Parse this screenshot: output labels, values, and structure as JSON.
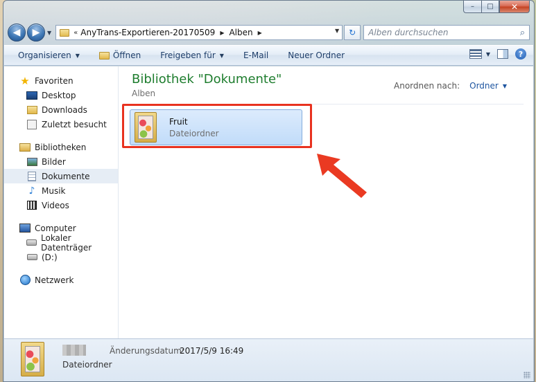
{
  "window": {
    "caption_minimize": "–",
    "caption_maximize": "□",
    "caption_close": "✕"
  },
  "navigation": {
    "back_icon": "◀",
    "forward_icon": "▶",
    "recent_dropdown": "▼"
  },
  "address_bar": {
    "overflow_chevron": "«",
    "segments": [
      "AnyTrans-Exportieren-20170509",
      "Alben"
    ],
    "separator": "▶",
    "dropdown": "▼",
    "refresh_icon": "↻"
  },
  "search": {
    "placeholder": "Alben durchsuchen",
    "icon": "⌕"
  },
  "toolbar": {
    "organize": "Organisieren",
    "open": "Öffnen",
    "share": "Freigeben für",
    "email": "E-Mail",
    "new_folder": "Neuer Ordner",
    "dropdown": "▼",
    "help": "?"
  },
  "sidebar": {
    "favorites": {
      "label": "Favoriten",
      "items": [
        "Desktop",
        "Downloads",
        "Zuletzt besucht"
      ]
    },
    "libraries": {
      "label": "Bibliotheken",
      "items": [
        "Bilder",
        "Dokumente",
        "Musik",
        "Videos"
      ],
      "selected": "Dokumente"
    },
    "computer": {
      "label": "Computer",
      "items": [
        "Lokaler Datenträger",
        "(D:)"
      ]
    },
    "network": {
      "label": "Netzwerk"
    }
  },
  "main": {
    "title": "Bibliothek \"Dokumente\"",
    "subtitle": "Alben",
    "arrange_label": "Anordnen nach:",
    "arrange_value": "Ordner",
    "folder": {
      "name": "Fruit",
      "type": "Dateiordner"
    }
  },
  "details": {
    "type": "Dateiordner",
    "date_label": "Änderungsdatum:",
    "date_value": "2017/5/9 16:49"
  },
  "colors": {
    "title_green": "#1e7d2e",
    "highlight_red": "#e8321f",
    "selection_blue": "#c1dcfa"
  }
}
